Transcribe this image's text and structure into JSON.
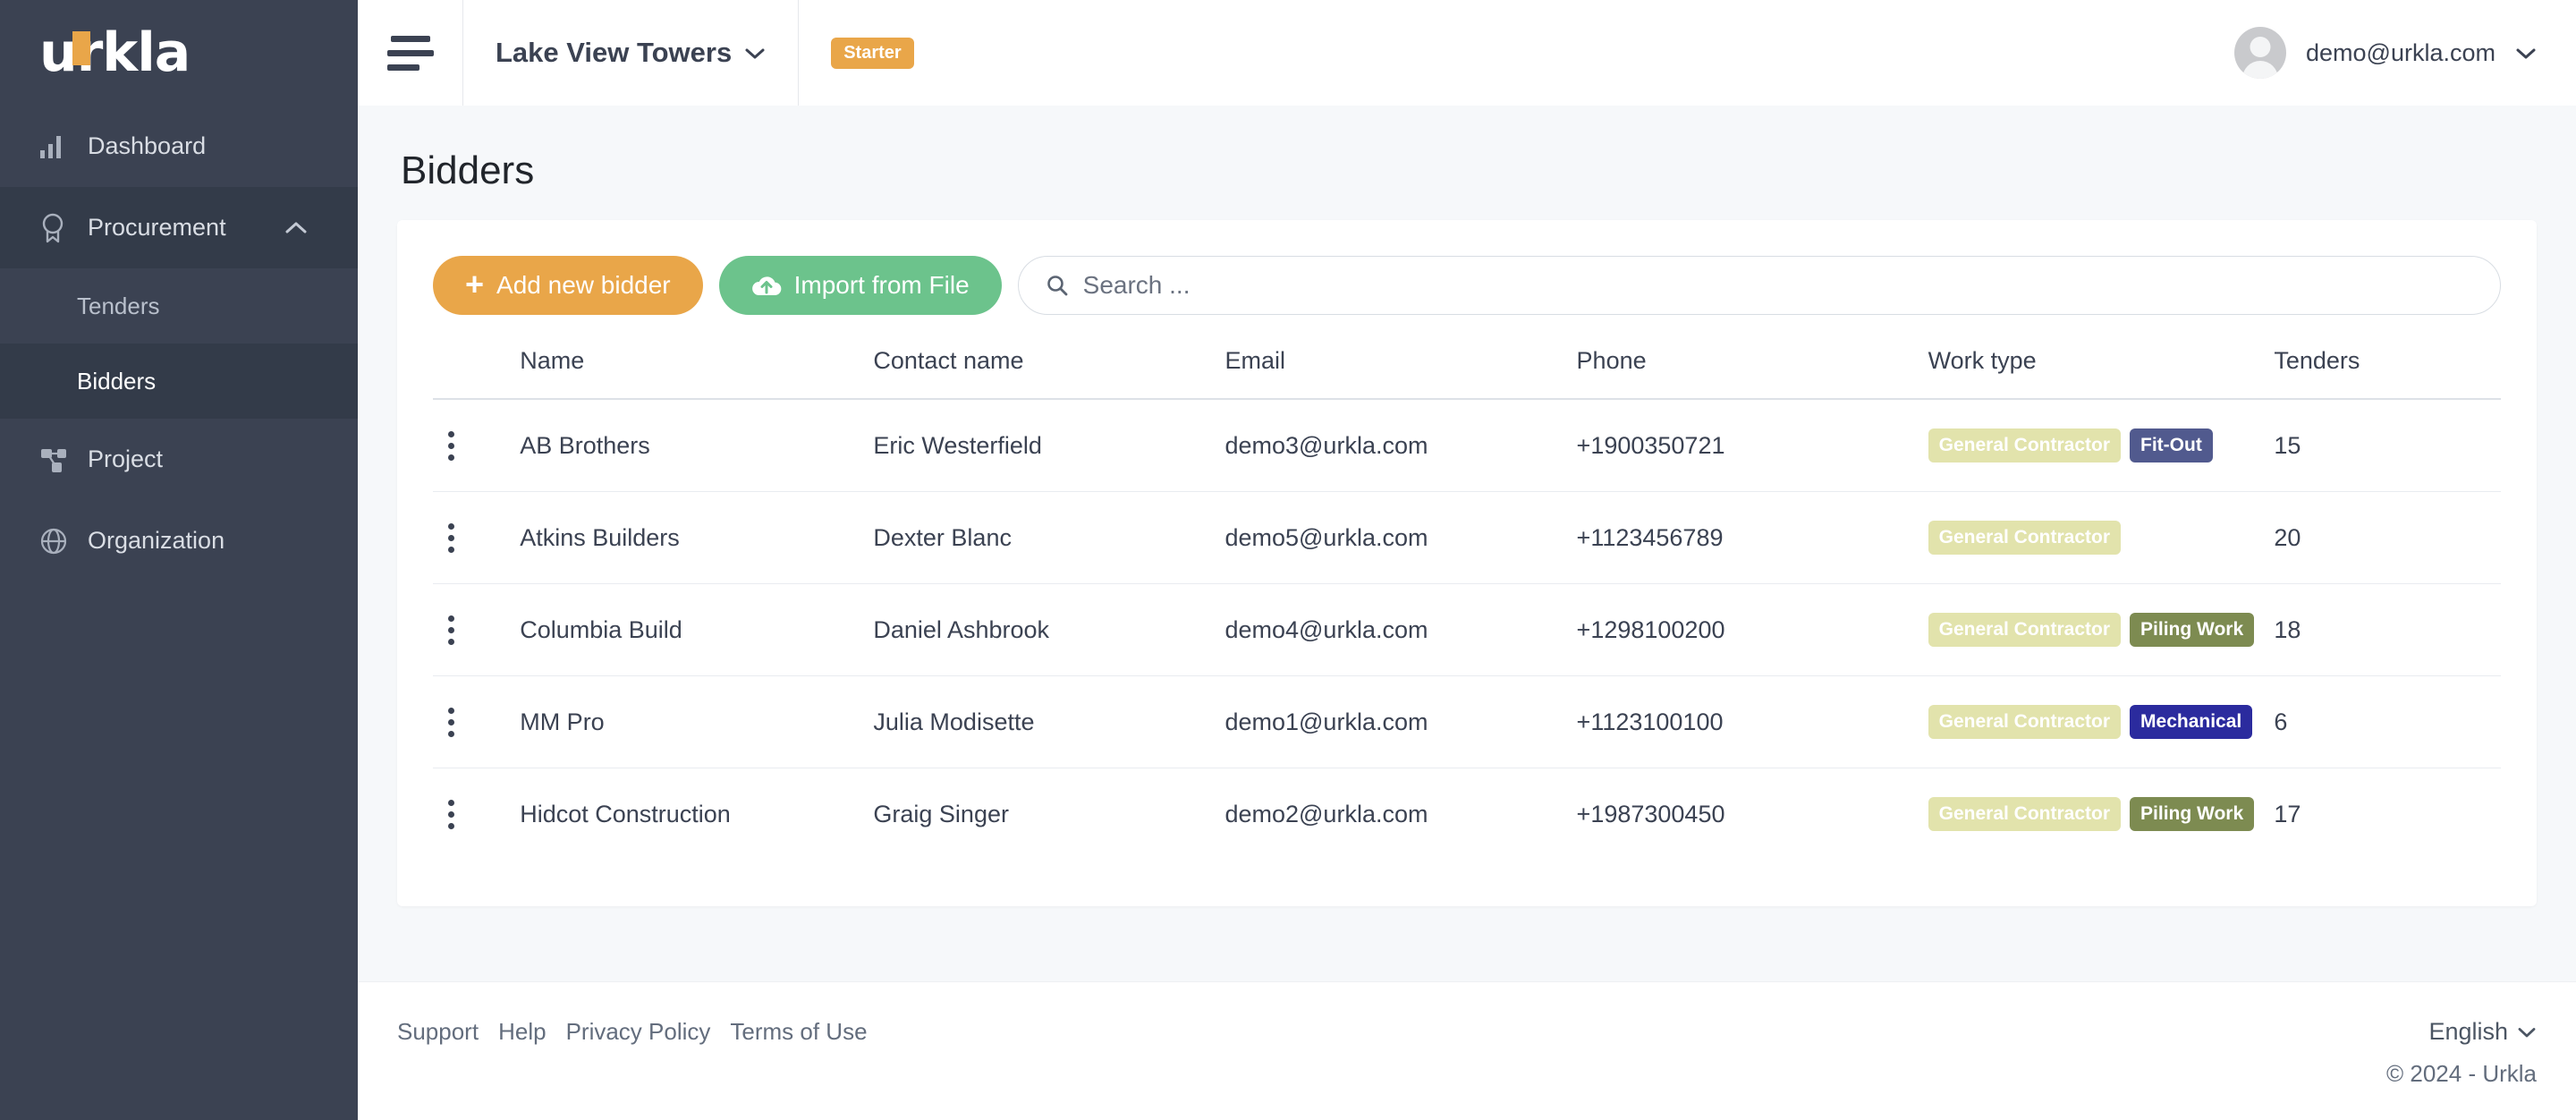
{
  "brand": {
    "name": "urkla",
    "accent_color": "#e9a649"
  },
  "sidebar": {
    "items": [
      {
        "label": "Dashboard",
        "icon": "bar-chart-icon"
      },
      {
        "label": "Procurement",
        "icon": "award-ribbon-icon",
        "expanded": true
      },
      {
        "label": "Project",
        "icon": "sitemap-icon"
      },
      {
        "label": "Organization",
        "icon": "globe-icon"
      }
    ],
    "procurement_children": [
      {
        "label": "Tenders",
        "selected": false
      },
      {
        "label": "Bidders",
        "selected": true
      }
    ]
  },
  "topbar": {
    "menu_icon": "hamburger-icon",
    "project_name": "Lake View Towers",
    "plan_badge": "Starter",
    "user_email": "demo@urkla.com"
  },
  "page": {
    "title": "Bidders"
  },
  "toolbar": {
    "add_label": "Add new bidder",
    "import_label": "Import from File",
    "search_placeholder": "Search ...",
    "search_value": ""
  },
  "table": {
    "columns": [
      "",
      "Name",
      "Contact name",
      "Email",
      "Phone",
      "Work type",
      "Tenders"
    ],
    "rows": [
      {
        "name": "AB Brothers",
        "contact": "Eric Westerfield",
        "email": "demo3@urkla.com",
        "phone": "+1900350721",
        "tags": [
          {
            "label": "General Contractor",
            "color": "#e2e3ac"
          },
          {
            "label": "Fit-Out",
            "color": "#515a8e"
          }
        ],
        "tenders": "15"
      },
      {
        "name": "Atkins Builders",
        "contact": "Dexter Blanc",
        "email": "demo5@urkla.com",
        "phone": "+1123456789",
        "tags": [
          {
            "label": "General Contractor",
            "color": "#e2e3ac"
          }
        ],
        "tenders": "20"
      },
      {
        "name": "Columbia Build",
        "contact": "Daniel Ashbrook",
        "email": "demo4@urkla.com",
        "phone": "+1298100200",
        "tags": [
          {
            "label": "General Contractor",
            "color": "#e2e3ac"
          },
          {
            "label": "Piling Work",
            "color": "#7d8b51"
          }
        ],
        "tenders": "18"
      },
      {
        "name": "MM Pro",
        "contact": "Julia Modisette",
        "email": "demo1@urkla.com",
        "phone": "+1123100100",
        "tags": [
          {
            "label": "General Contractor",
            "color": "#e2e3ac"
          },
          {
            "label": "Mechanical",
            "color": "#2b2b9e"
          }
        ],
        "tenders": "6"
      },
      {
        "name": "Hidcot Construction",
        "contact": "Graig Singer",
        "email": "demo2@urkla.com",
        "phone": "+1987300450",
        "tags": [
          {
            "label": "General Contractor",
            "color": "#e2e3ac"
          },
          {
            "label": "Piling Work",
            "color": "#7d8b51"
          }
        ],
        "tenders": "17"
      }
    ]
  },
  "footer": {
    "links": [
      "Support",
      "Help",
      "Privacy Policy",
      "Terms of Use"
    ],
    "language": "English",
    "copyright": "© 2024 - Urkla"
  }
}
